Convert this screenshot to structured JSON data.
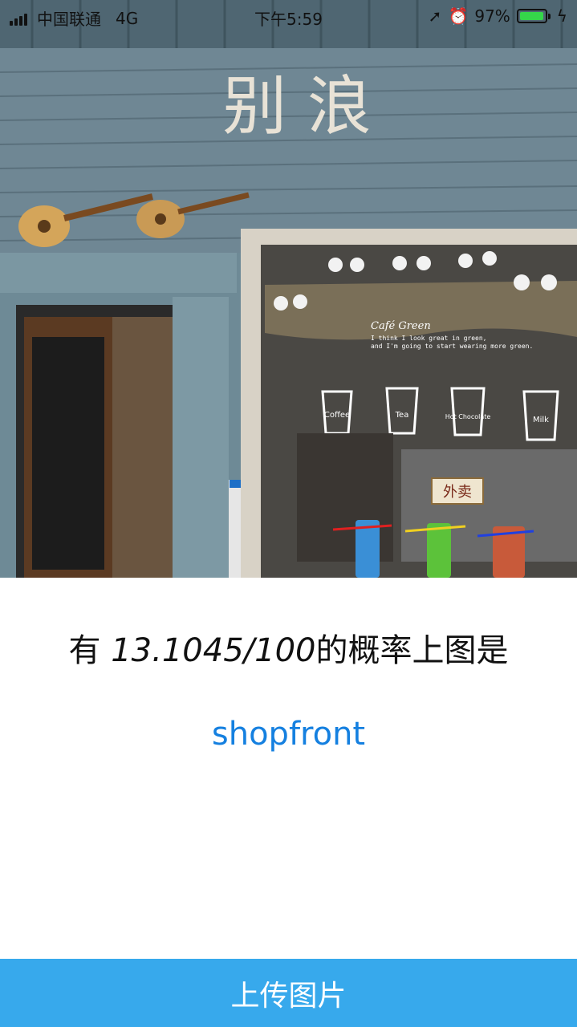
{
  "status_bar": {
    "carrier": "中国联通",
    "network": "4G",
    "time": "下午5:59",
    "battery": "97%",
    "battery_level": 0.97,
    "icons": [
      "signal-icon",
      "location-icon",
      "alarm-icon",
      "battery-icon",
      "charging-icon"
    ]
  },
  "photo": {
    "sign_text": "别 浪",
    "window_heading": "Café Green",
    "window_line1": "I think I look great in green,",
    "window_line2": "and I'm going to start wearing more green.",
    "cup_labels": [
      "Coffee",
      "Tea",
      "Hot Chocolate",
      "Milk"
    ],
    "hanging_sign": "外卖"
  },
  "result": {
    "prefix": "有 ",
    "probability": "13.1045/100",
    "suffix": "的概率上图是",
    "label": "shopfront"
  },
  "upload_button": "上传图片",
  "colors": {
    "accent": "#37a9ec",
    "label_link": "#1580e0",
    "battery_green": "#35d64a"
  }
}
